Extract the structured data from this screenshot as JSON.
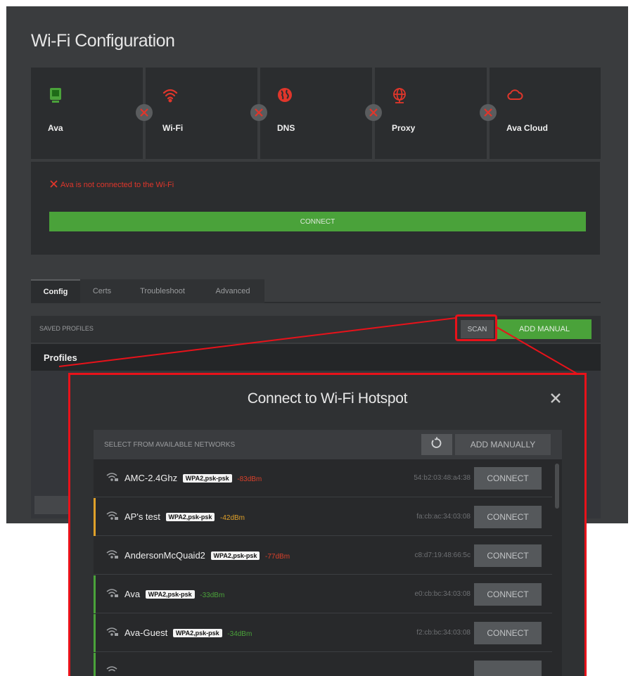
{
  "page": {
    "title": "Wi-Fi Configuration"
  },
  "status_cards": [
    {
      "label": "Ava",
      "icon": "device-icon",
      "color": "#4aa23a"
    },
    {
      "label": "Wi-Fi",
      "icon": "wifi-icon",
      "color": "#e0362b"
    },
    {
      "label": "DNS",
      "icon": "globe-icon",
      "color": "#e0362b"
    },
    {
      "label": "Proxy",
      "icon": "network-globe-icon",
      "color": "#e0362b"
    },
    {
      "label": "Ava Cloud",
      "icon": "cloud-icon",
      "color": "#e0362b"
    }
  ],
  "error": {
    "message": "Ava is not connected to the Wi-Fi",
    "connect_label": "CONNECT"
  },
  "tabs": [
    {
      "label": "Config",
      "active": true
    },
    {
      "label": "Certs",
      "active": false
    },
    {
      "label": "Troubleshoot",
      "active": false
    },
    {
      "label": "Advanced",
      "active": false
    }
  ],
  "saved_profiles": {
    "label": "SAVED PROFILES",
    "scan_label": "SCAN",
    "add_manual_label": "ADD MANUAL",
    "profiles_title": "Profiles"
  },
  "modal": {
    "title": "Connect to Wi-Fi Hotspot",
    "list_label": "SELECT FROM AVAILABLE NETWORKS",
    "add_manually_label": "ADD MANUALLY",
    "networks": [
      {
        "ssid": "AMC-2.4Ghz",
        "security": "WPA2,psk-psk",
        "rssi": "-83dBm",
        "rssi_color": "#d8402a",
        "mac": "54:b2:03:48:a4:38",
        "bar_color": "",
        "connect_label": "CONNECT"
      },
      {
        "ssid": "AP's test",
        "security": "WPA2,psk-psk",
        "rssi": "-42dBm",
        "rssi_color": "#e0a12a",
        "mac": "fa:cb:ac:34:03:08",
        "bar_color": "#e0a12a",
        "connect_label": "CONNECT"
      },
      {
        "ssid": "AndersonMcQuaid2",
        "security": "WPA2,psk-psk",
        "rssi": "-77dBm",
        "rssi_color": "#d8402a",
        "mac": "c8:d7:19:48:66:5c",
        "bar_color": "",
        "connect_label": "CONNECT"
      },
      {
        "ssid": "Ava",
        "security": "WPA2,psk-psk",
        "rssi": "-33dBm",
        "rssi_color": "#4aa23a",
        "mac": "e0:cb:bc:34:03:08",
        "bar_color": "#4aa23a",
        "connect_label": "CONNECT"
      },
      {
        "ssid": "Ava-Guest",
        "security": "WPA2,psk-psk",
        "rssi": "-34dBm",
        "rssi_color": "#4aa23a",
        "mac": "f2:cb:bc:34:03:08",
        "bar_color": "#4aa23a",
        "connect_label": "CONNECT"
      },
      {
        "ssid": "",
        "security": "",
        "rssi": "",
        "rssi_color": "#4aa23a",
        "mac": "",
        "bar_color": "#4aa23a",
        "connect_label": ""
      }
    ]
  }
}
